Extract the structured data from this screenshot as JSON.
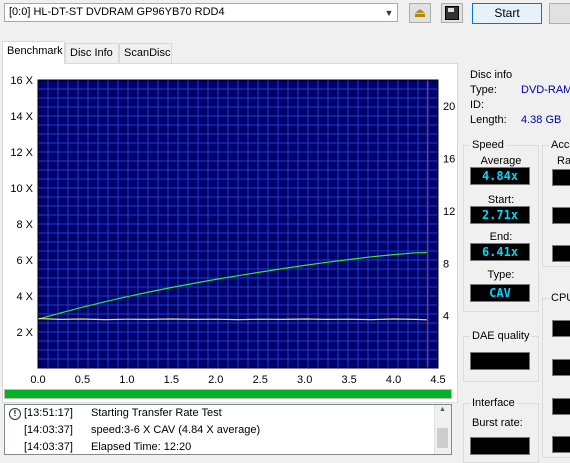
{
  "drive": {
    "selected": "[0:0]   HL-DT-ST DVDRAM GP96YB70 RDD4"
  },
  "toolbar": {
    "start_label": "Start"
  },
  "tabs": [
    {
      "label": "Benchmark",
      "active": true
    },
    {
      "label": "Disc Info",
      "active": false
    },
    {
      "label": "ScanDisc",
      "active": false
    }
  ],
  "chart_data": {
    "type": "line",
    "x_ticks": [
      "0.0",
      "0.5",
      "1.0",
      "1.5",
      "2.0",
      "2.5",
      "3.0",
      "3.5",
      "4.0",
      "4.5"
    ],
    "y_left_ticks": [
      "2 X",
      "4 X",
      "6 X",
      "8 X",
      "10 X",
      "12 X",
      "14 X",
      "16 X"
    ],
    "y_right_ticks": [
      "4",
      "8",
      "12",
      "16",
      "20"
    ],
    "xlim": [
      0,
      4.5
    ],
    "ylim_left": [
      0,
      16
    ],
    "ylim_right": [
      0,
      22
    ],
    "background": "#00006b",
    "grid": true,
    "end_marker_x": 4.38,
    "series": [
      {
        "color": "#32e632",
        "x": [
          0.0,
          0.25,
          0.5,
          0.75,
          1.0,
          1.25,
          1.5,
          1.75,
          2.0,
          2.25,
          2.5,
          2.75,
          3.0,
          3.25,
          3.5,
          3.75,
          4.0,
          4.25,
          4.38
        ],
        "values": [
          2.71,
          3.05,
          3.38,
          3.68,
          3.96,
          4.22,
          4.47,
          4.7,
          4.92,
          5.13,
          5.33,
          5.52,
          5.7,
          5.87,
          6.03,
          6.18,
          6.3,
          6.4,
          6.41
        ]
      },
      {
        "color": "#e6e650",
        "x": [
          0.0,
          0.25,
          0.5,
          0.75,
          1.0,
          1.25,
          1.5,
          1.75,
          2.0,
          2.25,
          2.5,
          2.75,
          3.0,
          3.25,
          3.5,
          3.75,
          4.0,
          4.25,
          4.38
        ],
        "values": [
          2.75,
          2.7,
          2.72,
          2.69,
          2.71,
          2.7,
          2.72,
          2.7,
          2.71,
          2.69,
          2.71,
          2.7,
          2.72,
          2.7,
          2.71,
          2.69,
          2.72,
          2.7,
          2.68
        ]
      }
    ]
  },
  "progress": {
    "fraction": 1.0,
    "color": "#06b025"
  },
  "log": [
    {
      "time": "[13:51:17]",
      "message": "Starting Transfer Rate Test"
    },
    {
      "time": "[14:03:37]",
      "message": "speed:3-6 X CAV (4.84 X average)"
    },
    {
      "time": "[14:03:37]",
      "message": "Elapsed Time: 12:20"
    }
  ],
  "disc_info": {
    "title": "Disc info",
    "type_label": "Type:",
    "type_value": "DVD-RAM",
    "id_label": "ID:",
    "id_value": "",
    "length_label": "Length:",
    "length_value": "4.38 GB"
  },
  "speed": {
    "title": "Speed",
    "average_label": "Average",
    "average_value": "4.84x",
    "start_label": "Start:",
    "start_value": "2.71x",
    "end_label": "End:",
    "end_value": "6.41x",
    "type_label": "Type:",
    "type_value": "CAV"
  },
  "access": {
    "title": "Acce",
    "random_label": "Ra"
  },
  "cpu": {
    "title": "CPU"
  },
  "dae": {
    "title": "DAE quality",
    "value": ""
  },
  "interface": {
    "title": "Interface",
    "burst_label": "Burst rate:",
    "burst_value": ""
  }
}
